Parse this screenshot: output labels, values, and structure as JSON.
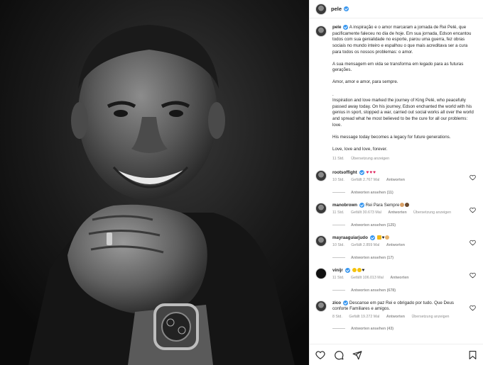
{
  "post": {
    "username": "pele",
    "caption_pt": "A inspiração e o amor marcaram a jornada de Rei Pelé, que pacificamente faleceu no dia de hoje. Em sua jornada, Edson encantou todos com sua genialidade no esporte, parou uma guerra, fez obras sociais no mundo inteiro e espalhou o que mais acreditava ser a cura para todos os nossos problemas: o amor.",
    "legacy_pt": "A sua mensagem em vida se transforma em legado para as futuras gerações.",
    "amor_pt": "Amor, amor e amor, para sempre.",
    "dot": ".",
    "caption_en": "Inspiration and love marked the journey of King Pelé, who peacefully passed away today. On his journey, Edson enchanted the world with his genius in sport, stopped a war, carried out social works all over the world and spread what he most believed to be the cure for all our problems: love.",
    "legacy_en": "His message today becomes a legacy for future generations.",
    "love_en": "Love, love and love, forever.",
    "time": "11 Std.",
    "see_translation": "Übersetzung anzeigen"
  },
  "comments": [
    {
      "user": "rootsoffight",
      "text": "",
      "emoji": "hearts",
      "time": "10 Std.",
      "likes": "Gefällt 2.767 Mal",
      "reply": "Antworten",
      "translate": "",
      "replies": "Antworten ansehen (11)"
    },
    {
      "user": "manobrown",
      "text": "Rei Para Sempre",
      "emoji": "pray",
      "time": "11 Std.",
      "likes": "Gefällt 30.673 Mal",
      "reply": "Antworten",
      "translate": "Übersetzung anzeigen",
      "replies": "Antworten ansehen (125)"
    },
    {
      "user": "mayraaguiarjudo",
      "text": "",
      "emoji": "crown-heart-pray",
      "time": "10 Std.",
      "likes": "Gefällt 2.859 Mal",
      "reply": "Antworten",
      "translate": "",
      "replies": "Antworten ansehen (17)"
    },
    {
      "user": "vinijr",
      "text": "",
      "emoji": "faces-heart",
      "time": "11 Std.",
      "likes": "Gefällt 106.013 Mal",
      "reply": "Antworten",
      "translate": "",
      "replies": "Antworten ansehen (678)"
    },
    {
      "user": "zico",
      "text": "Descanse em paz Rei e obrigado por tudo. Que Deus conforte Familiares e amigos.",
      "emoji": "",
      "time": "8 Std.",
      "likes": "Gefällt 19.272 Mal",
      "reply": "Antworten",
      "translate": "Übersetzung anzeigen",
      "replies": "Antworten ansehen (43)"
    }
  ],
  "icons": {
    "like": "heart-icon",
    "comment": "comment-icon",
    "share": "share-icon",
    "save": "bookmark-icon"
  },
  "colors": {
    "verified": "#3897f0",
    "meta": "#8e8e8e",
    "heart": "#e0245e"
  }
}
